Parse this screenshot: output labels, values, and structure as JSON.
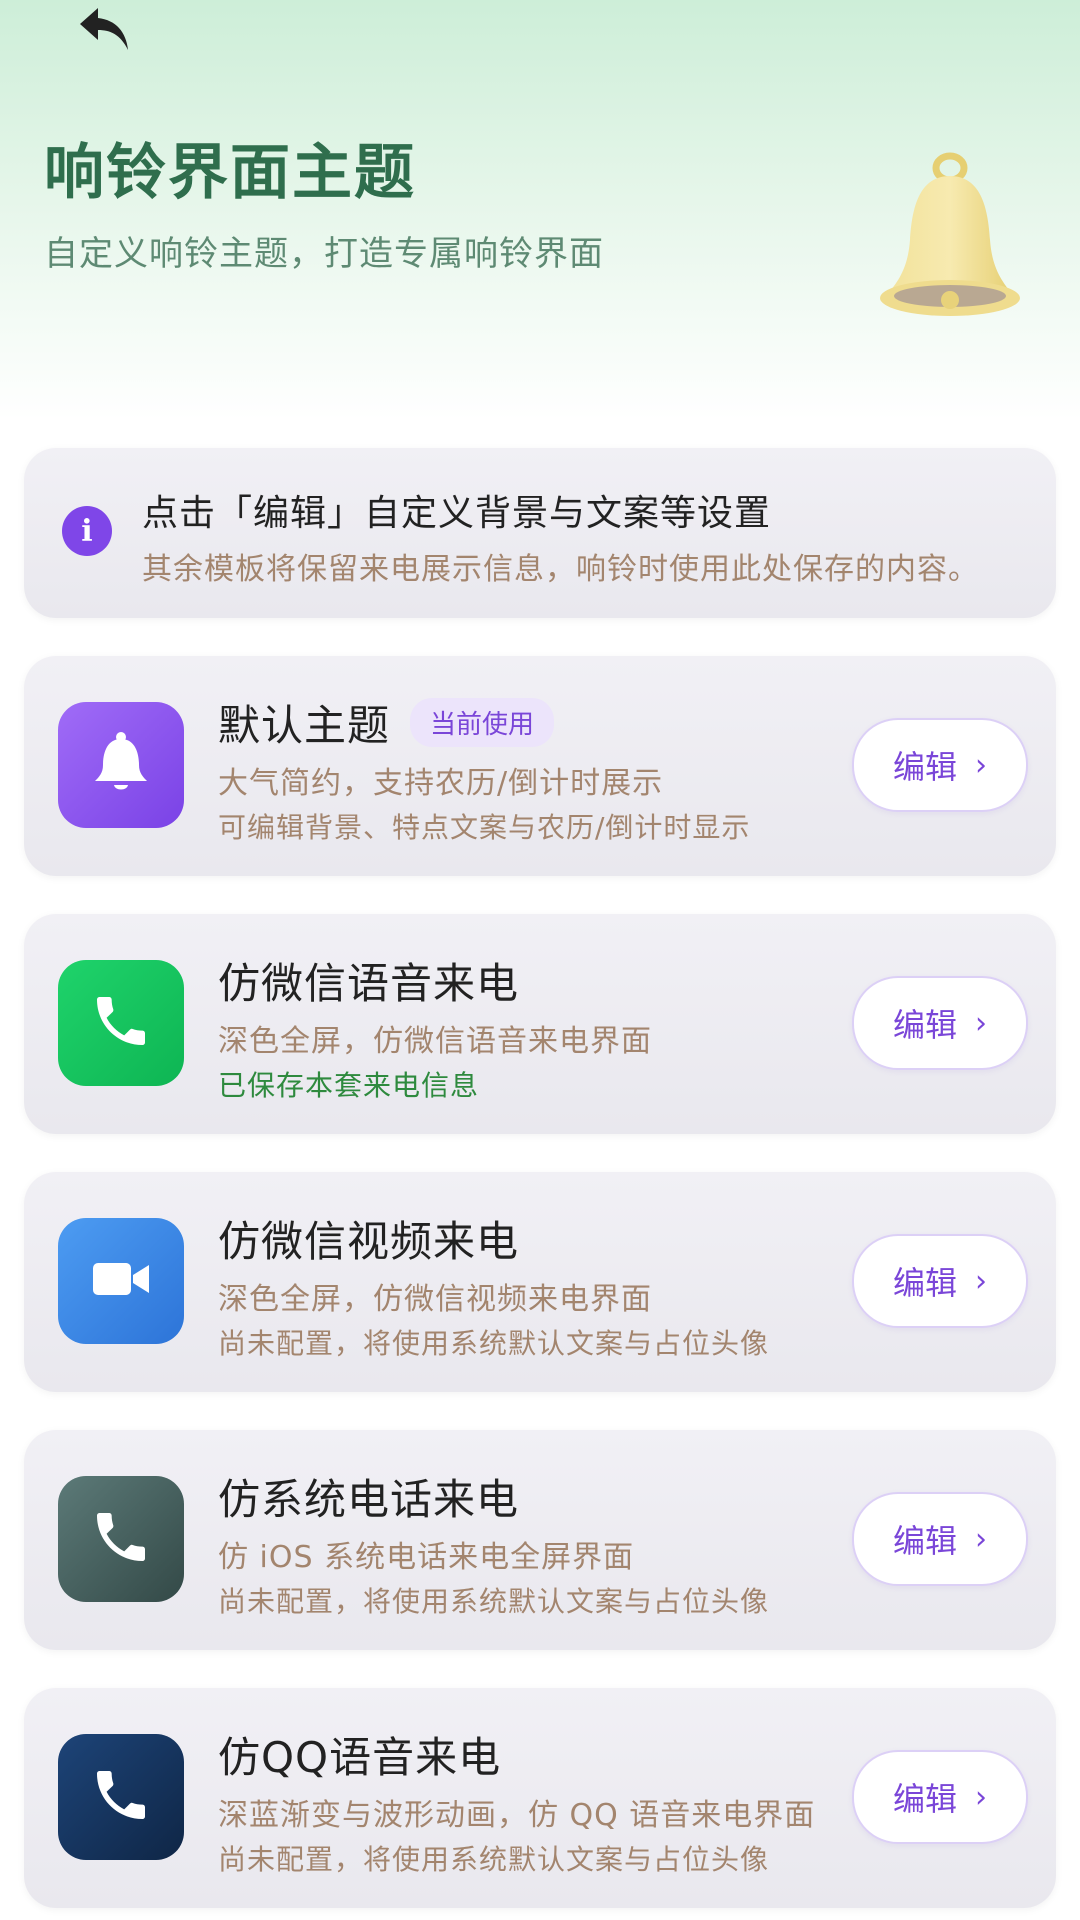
{
  "header": {
    "back_icon": "back-arrow-icon",
    "title": "响铃界面主题",
    "subtitle": "自定义响铃主题，打造专属响铃界面",
    "illustration": "bell-icon"
  },
  "info": {
    "icon": "info-icon",
    "icon_glyph": "i",
    "title": "点击「编辑」自定义背景与文案等设置",
    "desc": "其余模板将保留来电展示信息，响铃时使用此处保存的内容。"
  },
  "themes": [
    {
      "title": "默认主题",
      "badge": "当前使用",
      "desc": "大气简约，支持农历/倒计时展示",
      "status": "可编辑背景、特点文案与农历/倒计时显示",
      "icon": "bell-icon",
      "color": "#8a55ef",
      "edit_label": "编辑",
      "chevron": "›"
    },
    {
      "title": "仿微信语音来电",
      "desc": "深色全屏，仿微信语音来电界面",
      "status": "已保存本套来电信息",
      "icon": "phone-icon",
      "color": "#12c15c",
      "edit_label": "编辑",
      "chevron": "›"
    },
    {
      "title": "仿微信视频来电",
      "desc": "深色全屏，仿微信视频来电界面",
      "status": "尚未配置，将使用系统默认文案与占位头像",
      "icon": "video-camera-icon",
      "color": "#3b88e6",
      "edit_label": "编辑",
      "chevron": "›"
    },
    {
      "title": "仿系统电话来电",
      "desc": "仿 iOS 系统电话来电全屏界面",
      "status": "尚未配置，将使用系统默认文案与占位头像",
      "icon": "phone-icon",
      "color": "#45615f",
      "edit_label": "编辑",
      "chevron": "›"
    },
    {
      "title": "仿QQ语音来电",
      "desc": "深蓝渐变与波形动画，仿 QQ 语音来电界面",
      "status": "尚未配置，将使用系统默认文案与占位头像",
      "icon": "phone-icon",
      "color": "#16335c",
      "edit_label": "编辑",
      "chevron": "›"
    }
  ]
}
